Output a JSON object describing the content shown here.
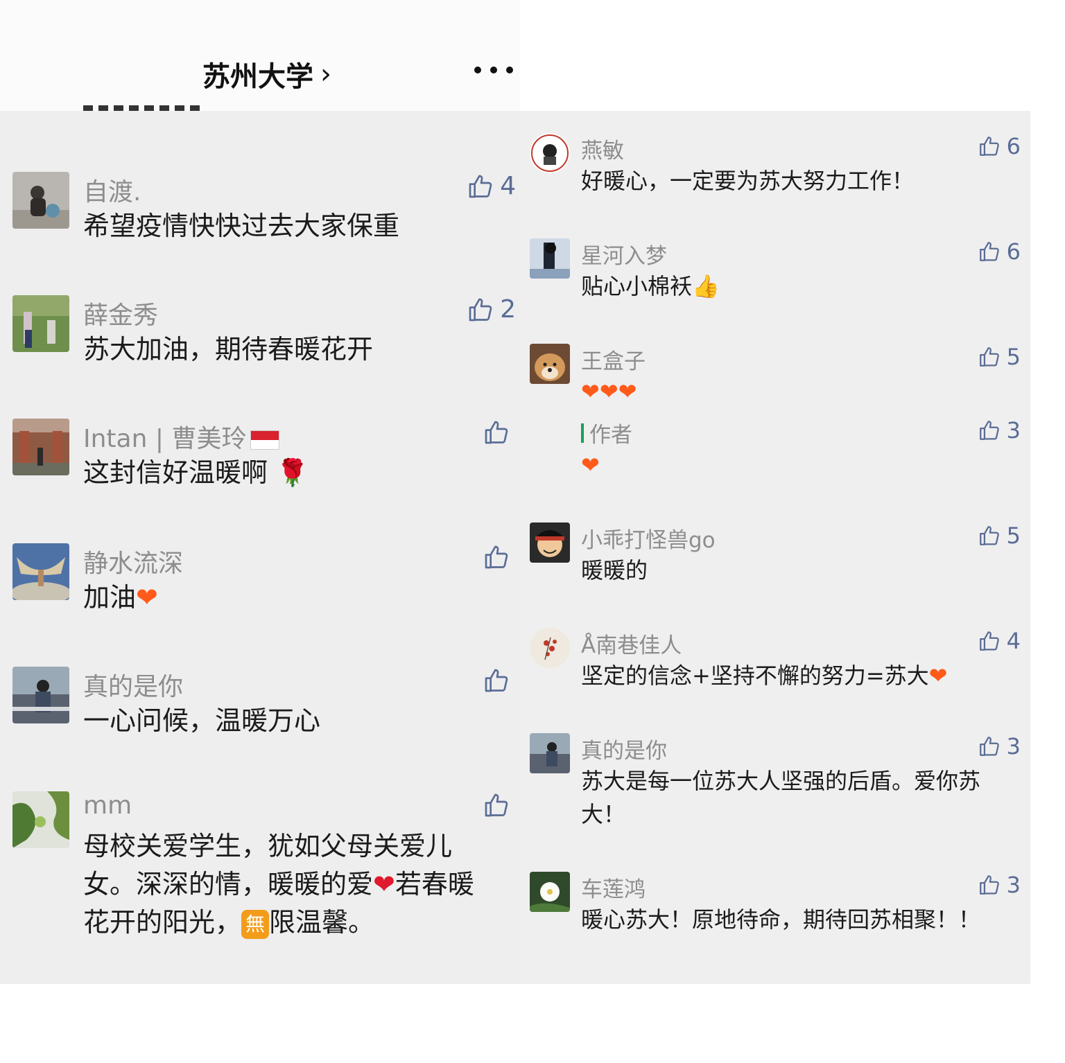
{
  "header": {
    "title": "苏州大学",
    "chevron": "›"
  },
  "left_comments": [
    {
      "name": "自渡.",
      "text": "希望疫情快快过去大家保重",
      "likes": "4"
    },
    {
      "name": "薛金秀",
      "text": "苏大加油，期待春暖花开",
      "likes": "2"
    },
    {
      "name": "Intan | 曹美玲",
      "text": "这封信好温暖啊",
      "emoji": "🌹",
      "likes": ""
    },
    {
      "name": "静水流深",
      "text": "加油",
      "emoji": "❤",
      "likes": ""
    },
    {
      "name": "真的是你",
      "text": "一心问候，温暖万心",
      "likes": ""
    },
    {
      "name": "mm",
      "text_a": "母校关爱学生，犹如父母关爱儿女。深深的情，暖暖的爱",
      "heart": "❤",
      "text_b": "若春暖花开的阳光，",
      "badge": "無",
      "text_c": "限温馨。",
      "likes": ""
    }
  ],
  "right_comments": [
    {
      "name": "燕敏",
      "text": "好暖心，一定要为苏大努力工作！",
      "likes": "6"
    },
    {
      "name": "星河入梦",
      "text": "贴心小棉袄",
      "emoji": "👍",
      "likes": "6"
    },
    {
      "name": "王盒子",
      "text": "❤❤❤",
      "likes": "5"
    },
    {
      "name": "作者",
      "text": "❤",
      "likes": "3"
    },
    {
      "name": "小乖打怪兽go",
      "text": "暖暖的",
      "likes": "5"
    },
    {
      "name": "Å南巷佳人",
      "text": "坚定的信念+坚持不懈的努力=苏大",
      "emoji": "❤",
      "likes": "4"
    },
    {
      "name": "真的是你",
      "text": "苏大是每一位苏大人坚强的后盾。爱你苏大！",
      "likes": "3"
    },
    {
      "name": "车莲鸿",
      "text": "暖心苏大！原地待命，期待回苏相聚！！",
      "likes": "3"
    }
  ],
  "colors": {
    "accent_like": "#5a6c95",
    "name_gray": "#8d8d8d",
    "heart": "#ff5a1a",
    "author_green": "#19a05a"
  },
  "icons": {
    "like": "thumbs-up-icon",
    "more": "more-dots-icon"
  }
}
